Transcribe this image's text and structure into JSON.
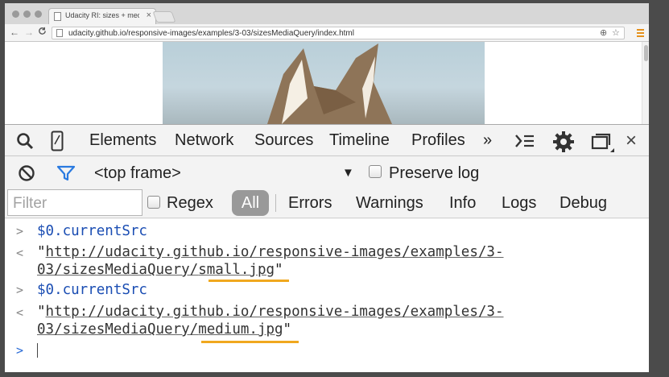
{
  "browser": {
    "tab_title": "Udacity RI: sizes + media",
    "tab_close": "×",
    "url": "udacity.github.io/responsive-images/examples/3-03/sizesMediaQuery/index.html",
    "back": "←",
    "forward": "→",
    "reload": "C",
    "zoom_icon": "⊕",
    "star_icon": "☆"
  },
  "devtools": {
    "tabs": [
      "Elements",
      "Network",
      "Sources",
      "Timeline",
      "Profiles"
    ],
    "more": "»",
    "close": "×"
  },
  "console_bar": {
    "context": "<top frame>",
    "dropdown": "▼",
    "preserve_log": "Preserve log"
  },
  "filter_bar": {
    "placeholder": "Filter",
    "regex": "Regex",
    "levels": [
      "All",
      "Errors",
      "Warnings",
      "Info",
      "Logs",
      "Debug"
    ]
  },
  "console": {
    "prompt": ">",
    "result": "<",
    "entries": [
      {
        "command": "$0.currentSrc",
        "quote_open": "\"",
        "line1": "http://udacity.github.io/responsive-images/examples/3-",
        "line2_prefix": "03/sizesMediaQuery/",
        "line2_file": "small.jpg",
        "quote_close": "\""
      },
      {
        "command": "$0.currentSrc",
        "quote_open": "\"",
        "line1": "http://udacity.github.io/responsive-images/examples/3-",
        "line2_prefix": "03/sizesMediaQuery/",
        "line2_file": "medium.jpg",
        "quote_close": "\""
      }
    ]
  },
  "colors": {
    "highlight": "#f0a81f",
    "command": "#1a4db3",
    "active_filter": "#999999"
  }
}
